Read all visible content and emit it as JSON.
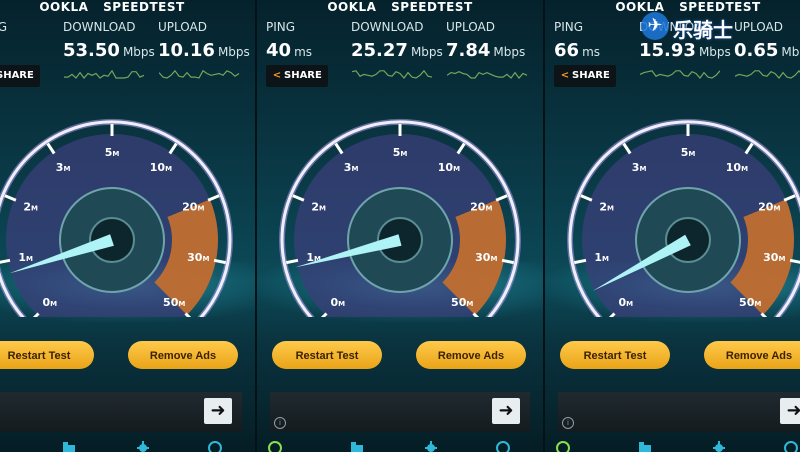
{
  "header": {
    "brand": "OOKLA",
    "title": "SPEEDTEST"
  },
  "labels": {
    "ping": "PING",
    "download": "DOWNLOAD",
    "upload": "UPLOAD",
    "unit_ms": "ms",
    "unit_mbps": "Mbps",
    "share": "SHARE"
  },
  "gauge": {
    "ticks": [
      "0",
      "1",
      "2",
      "3",
      "5",
      "10",
      "20",
      "30",
      "50"
    ],
    "tick_unit": "M"
  },
  "buttons": {
    "restart": "Restart Test",
    "remove_ads": "Remove Ads"
  },
  "ad": {
    "arrow": "➜",
    "info": "i"
  },
  "panels": [
    {
      "ping": "",
      "download": "53.50",
      "upload": "10.16",
      "needle_mbps": 0.8
    },
    {
      "ping": "40",
      "download": "25.27",
      "upload": "7.84",
      "needle_mbps": 0.9
    },
    {
      "ping": "66",
      "download": "15.93",
      "upload": "0.65",
      "needle_mbps": 0.5
    }
  ],
  "watermark": {
    "icon": "bird-icon",
    "text": "乐骑士"
  },
  "colors": {
    "accent": "#f29a1e",
    "button": "#f5b632",
    "gauge_arc": "#d9d4f5",
    "gauge_hot": "#e07a2c",
    "teal": "#2fc8d0"
  }
}
